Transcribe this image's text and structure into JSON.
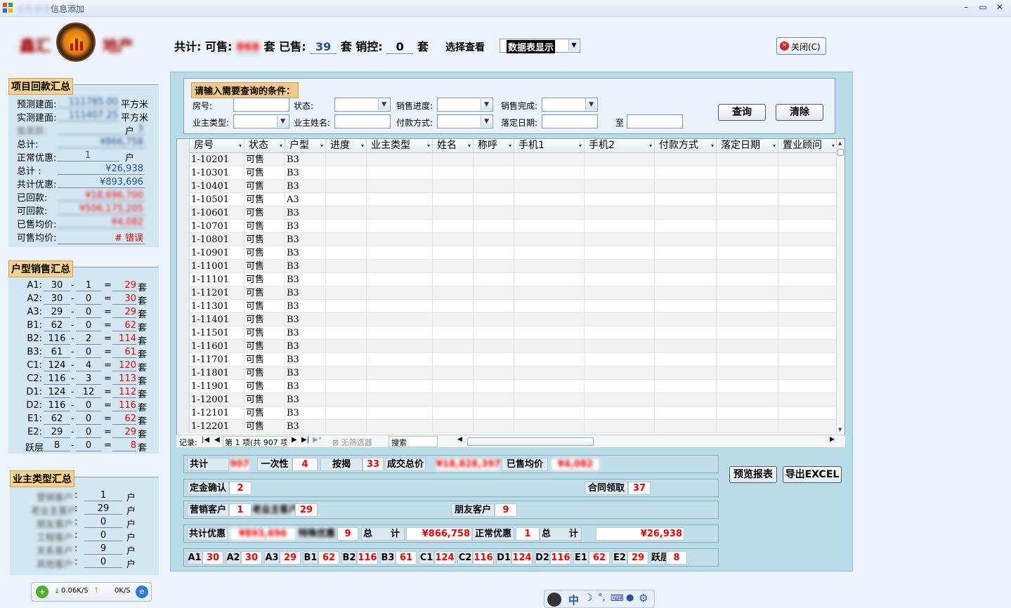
{
  "window": {
    "title": "信息添加",
    "title_blurred": "销售管理"
  },
  "header": {
    "total_label": "共计:",
    "avail_label": "可售:",
    "avail_val": "868",
    "sold_label": "套 已售:",
    "sold_val": "39",
    "ctl_label": "套 销控:",
    "ctl_val": "0",
    "unit": "套",
    "view_label": "选择查看",
    "view_value": "数据表显示",
    "close_label": "关闭(C)"
  },
  "brand": {
    "left_text": "鑫汇",
    "right_text": "地产"
  },
  "proj": {
    "title": "项目回款汇总",
    "rows": [
      {
        "label": "预测建面:",
        "value": "111785.00",
        "unit": "平方米"
      },
      {
        "label": "实测建面:",
        "value": "111407.25",
        "unit": "平方米"
      },
      {
        "label": "备案数:",
        "value": "3",
        "unit": "户"
      },
      {
        "label": "总计:",
        "value": "¥866,758",
        "unit": ""
      },
      {
        "label": "正常优惠:",
        "value": "1",
        "unit": "户"
      },
      {
        "label": "总计 :",
        "value": "¥26,938",
        "unit": ""
      },
      {
        "label": "共计优惠:",
        "value": "¥893,696",
        "unit": ""
      },
      {
        "label": "已回款:",
        "value": "¥18,696,700",
        "unit": ""
      },
      {
        "label": "可回款:",
        "value": "¥506,175,205",
        "unit": ""
      },
      {
        "label": "已售均价:",
        "value": "¥4,082",
        "unit": ""
      },
      {
        "label": "可售均价:",
        "value": "# 错误",
        "unit": ""
      }
    ]
  },
  "types": {
    "title": "户型销售汇总",
    "unit": "套",
    "rows": [
      {
        "t": "A1:",
        "a": "30",
        "b": "1",
        "c": "29"
      },
      {
        "t": "A2:",
        "a": "30",
        "b": "0",
        "c": "30"
      },
      {
        "t": "A3:",
        "a": "29",
        "b": "0",
        "c": "29"
      },
      {
        "t": "B1:",
        "a": "62",
        "b": "0",
        "c": "62"
      },
      {
        "t": "B2:",
        "a": "116",
        "b": "2",
        "c": "114"
      },
      {
        "t": "B3:",
        "a": "61",
        "b": "0",
        "c": "61"
      },
      {
        "t": "C1:",
        "a": "124",
        "b": "4",
        "c": "120"
      },
      {
        "t": "C2:",
        "a": "116",
        "b": "3",
        "c": "113"
      },
      {
        "t": "D1:",
        "a": "124",
        "b": "12",
        "c": "112"
      },
      {
        "t": "D2:",
        "a": "116",
        "b": "0",
        "c": "116"
      },
      {
        "t": "E1:",
        "a": "62",
        "b": "0",
        "c": "62"
      },
      {
        "t": "E2:",
        "a": "29",
        "b": "0",
        "c": "29"
      },
      {
        "t": "跃层",
        "a": "8",
        "b": "0",
        "c": "8"
      }
    ]
  },
  "owners": {
    "title": "业主类型汇总",
    "unit": "户",
    "rows": [
      {
        "label": "营销客户",
        "value": "1"
      },
      {
        "label": "老业主客户",
        "value": "29"
      },
      {
        "label": "朋友客户",
        "value": "0"
      },
      {
        "label": "工程客户",
        "value": "0"
      },
      {
        "label": "关系客户",
        "value": "9"
      },
      {
        "label": "其他客户",
        "value": "0"
      }
    ]
  },
  "query": {
    "title": "请输入需要查询的条件：",
    "room": "房号:",
    "status": "状态:",
    "progress": "销售进度:",
    "done": "销售完成:",
    "owner_type": "业主类型:",
    "owner_name": "业主姓名:",
    "pay": "付款方式:",
    "date": "落定日期:",
    "to": "至",
    "search": "查询",
    "clear": "清除"
  },
  "grid": {
    "columns": [
      "房号",
      "状态",
      "户型",
      "进度",
      "业主类型",
      "姓名",
      "称呼",
      "手机1",
      "手机2",
      "付款方式",
      "落定日期",
      "置业顾问"
    ],
    "rows": [
      [
        "1-10201",
        "可售",
        "B3"
      ],
      [
        "1-10301",
        "可售",
        "B3"
      ],
      [
        "1-10401",
        "可售",
        "B3"
      ],
      [
        "1-10501",
        "可售",
        "A3"
      ],
      [
        "1-10601",
        "可售",
        "B3"
      ],
      [
        "1-10701",
        "可售",
        "B3"
      ],
      [
        "1-10801",
        "可售",
        "B3"
      ],
      [
        "1-10901",
        "可售",
        "B3"
      ],
      [
        "1-11001",
        "可售",
        "B3"
      ],
      [
        "1-11101",
        "可售",
        "B3"
      ],
      [
        "1-11201",
        "可售",
        "B3"
      ],
      [
        "1-11301",
        "可售",
        "B3"
      ],
      [
        "1-11401",
        "可售",
        "B3"
      ],
      [
        "1-11501",
        "可售",
        "B3"
      ],
      [
        "1-11601",
        "可售",
        "B3"
      ],
      [
        "1-11701",
        "可售",
        "B3"
      ],
      [
        "1-11801",
        "可售",
        "B3"
      ],
      [
        "1-11901",
        "可售",
        "B3"
      ],
      [
        "1-12001",
        "可售",
        "B3"
      ],
      [
        "1-12101",
        "可售",
        "B3"
      ],
      [
        "1-12201",
        "可售",
        "B3"
      ]
    ],
    "nav": {
      "record": "记录:",
      "pos": "第 1 项(共 907 项)",
      "filter": "无筛选器",
      "search": "搜索"
    }
  },
  "summary": {
    "total": "共计",
    "total_v": "907",
    "once": "一次性",
    "once_v": "4",
    "mort": "按揭",
    "mort_v": "33",
    "deal": "成交总价",
    "deal_v": "¥18,828,397",
    "avg": "已售均价",
    "avg_v": "¥4,082",
    "dep": "定金确认",
    "dep_v": "2",
    "contract": "合同领取",
    "contract_v": "37",
    "market": "营销客户",
    "market_v": "1",
    "old": "老业主客户",
    "old_v": "29",
    "friend": "朋友客户",
    "friend_v": "9",
    "disc": "共计优惠",
    "disc_blur": "¥893,696",
    "disc_blur2": "特殊优惠",
    "disc_v": "9",
    "tot": "总",
    "ji": "计",
    "tot_v": "¥866,758",
    "normal": "正常优惠",
    "normal_v": "1",
    "tot2_v": "¥26,938",
    "types": [
      [
        "A1",
        "30"
      ],
      [
        "A2",
        "30"
      ],
      [
        "A3",
        "29"
      ],
      [
        "B1",
        "62"
      ],
      [
        "B2",
        "116"
      ],
      [
        "B3",
        "61"
      ],
      [
        "C1",
        "124"
      ],
      [
        "C2",
        "116"
      ],
      [
        "D1",
        "124"
      ],
      [
        "D2",
        "116"
      ],
      [
        "E1",
        "62"
      ],
      [
        "E2",
        "29"
      ],
      [
        "跃层",
        "8"
      ]
    ],
    "preview": "预览报表",
    "export": "导出EXCEL"
  },
  "tray": {
    "down": "0.06K/S",
    "up": "0K/S"
  },
  "ime": {
    "lang": "中"
  }
}
